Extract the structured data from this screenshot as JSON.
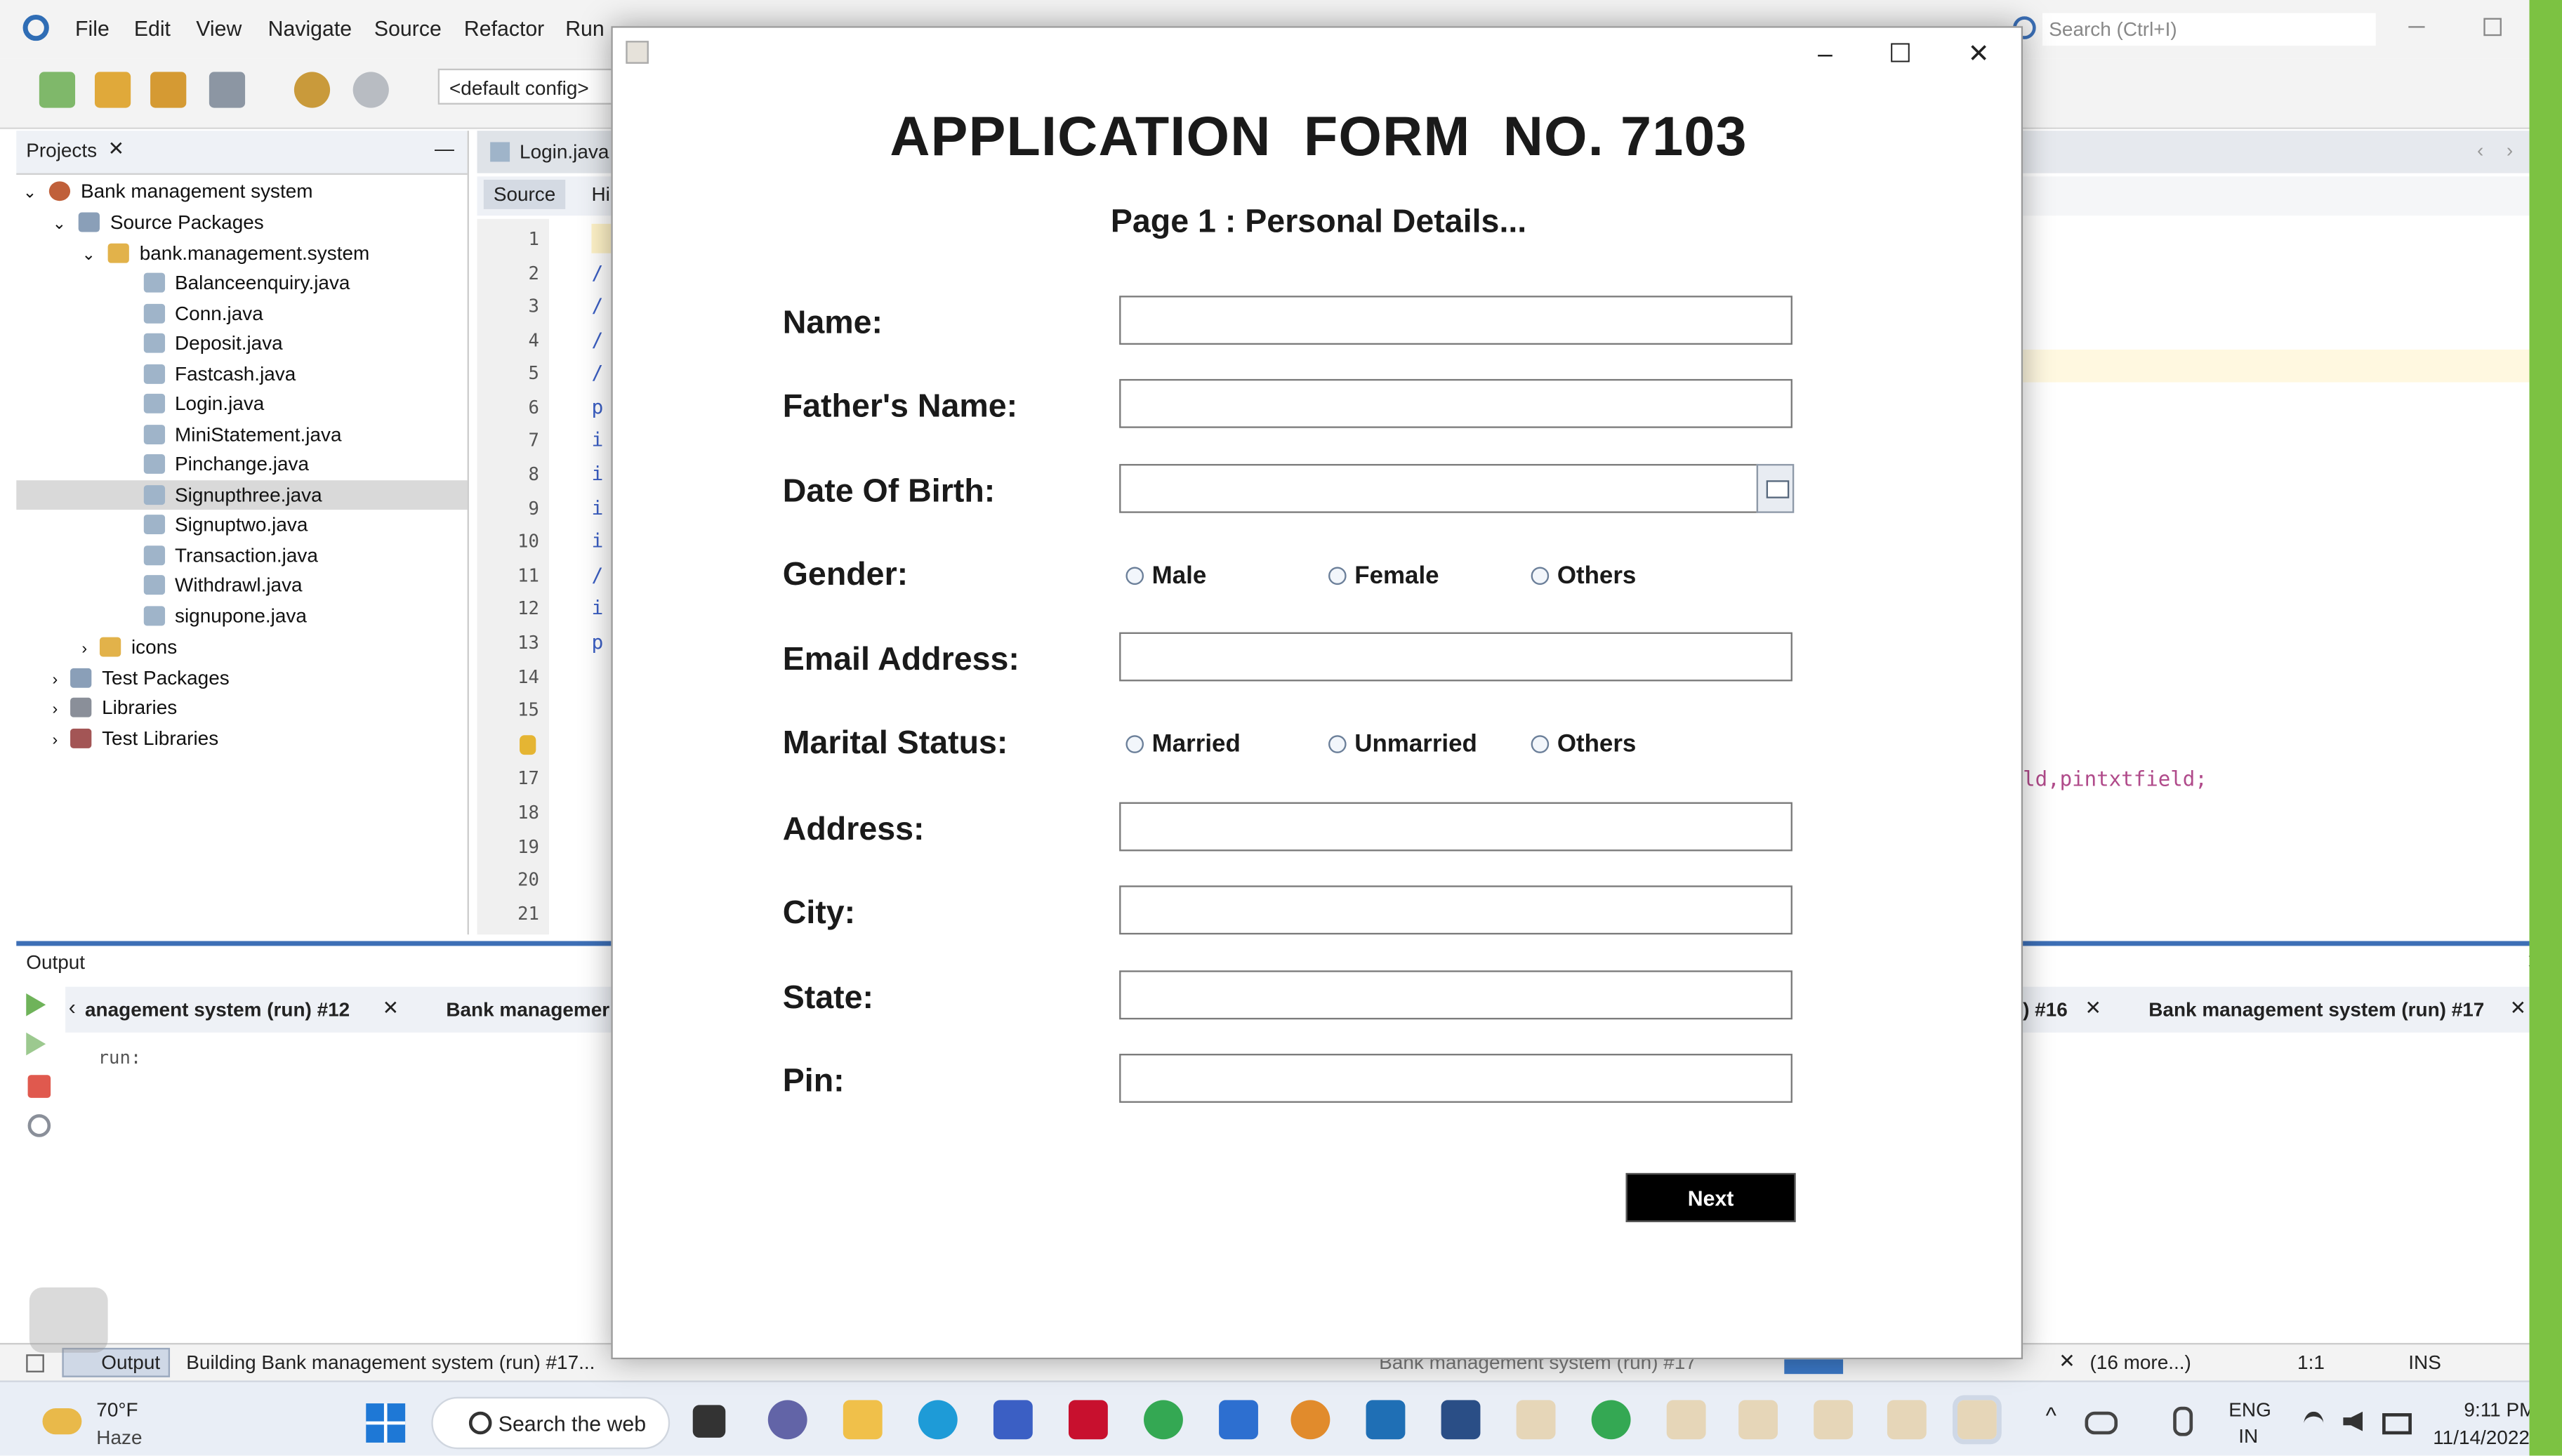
{
  "ide": {
    "menu": [
      "File",
      "Edit",
      "View",
      "Navigate",
      "Source",
      "Refactor",
      "Run"
    ],
    "search_placeholder": "Search (Ctrl+I)",
    "config": "<default config>",
    "projects_tab": "Projects",
    "tree": {
      "project": "Bank management system",
      "source_packages": "Source Packages",
      "package": "bank.management.system",
      "files": [
        "Balanceenquiry.java",
        "Conn.java",
        "Deposit.java",
        "Fastcash.java",
        "Login.java",
        "MiniStatement.java",
        "Pinchange.java",
        "Signupthree.java",
        "Signuptwo.java",
        "Transaction.java",
        "Withdrawl.java",
        "signupone.java"
      ],
      "icons": "icons",
      "test_packages": "Test Packages",
      "libraries": "Libraries",
      "test_libraries": "Test Libraries"
    },
    "editor_tab": "Login.java",
    "source_tab": "Source",
    "history_tab": "Hi",
    "line_numbers": [
      "1",
      "2",
      "3",
      "4",
      "5",
      "6",
      "7",
      "8",
      "9",
      "10",
      "11",
      "12",
      "13",
      "14",
      "15",
      "",
      "17",
      "18",
      "19",
      "20",
      "21"
    ],
    "code_fragments": [
      "/",
      "/",
      "/",
      "/",
      "p",
      "i",
      "i",
      "i",
      "i",
      "/",
      "i",
      "p"
    ],
    "code_right": "ld,pintxtfield;",
    "output_title": "Output",
    "output_tabs": {
      "left": "anagement system (run) #12",
      "second": "Bank managemer",
      "run16": ") #16",
      "run17": "Bank management system (run) #17"
    },
    "output_text": "run:",
    "status": {
      "output": "Output",
      "building": "Building Bank management system (run) #17...",
      "middle": "Bank management system (run) #17",
      "more": "(16 more...)",
      "position": "1:1",
      "mode": "INS"
    }
  },
  "dialog": {
    "title": "APPLICATION  FORM  NO. 7103",
    "subtitle": "Page 1 : Personal Details...",
    "fields": {
      "name": "Name:",
      "father": "Father's Name:",
      "dob": "Date Of Birth:",
      "gender": "Gender:",
      "email": "Email Address:",
      "marital": "Marital Status:",
      "address": "Address:",
      "city": "City:",
      "state": "State:",
      "pin": "Pin:"
    },
    "gender_options": [
      "Male",
      "Female",
      "Others"
    ],
    "marital_options": [
      "Married",
      "Unmarried",
      "Others"
    ],
    "next_label": "Next"
  },
  "taskbar": {
    "weather_temp": "70°F",
    "weather_desc": "Haze",
    "search": "Search the web",
    "lang_top": "ENG",
    "lang_bottom": "IN",
    "time": "9:11 PM",
    "date": "11/14/2022"
  }
}
